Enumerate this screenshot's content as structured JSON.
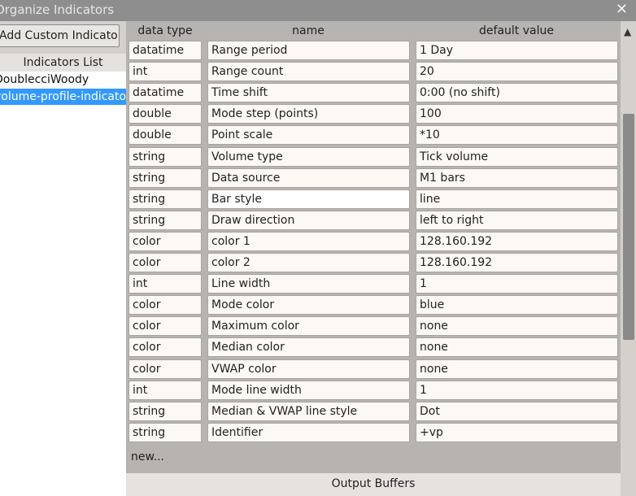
{
  "window": {
    "title": "Organize Indicators",
    "close_icon": "close-icon"
  },
  "sidebar": {
    "add_button_label": "Add Custom Indicator",
    "list_header": "Indicators List",
    "items": [
      {
        "label": "DoublecciWoody",
        "selected": false
      },
      {
        "label": "volume-profile-indicator",
        "selected": true
      }
    ]
  },
  "table": {
    "headers": {
      "type": "data type",
      "name": "name",
      "default": "default value"
    },
    "rows": [
      {
        "type": "datatime",
        "name": "Range period",
        "value": "1 Day"
      },
      {
        "type": "int",
        "name": "Range count",
        "value": "20"
      },
      {
        "type": "datatime",
        "name": "Time shift",
        "value": "0:00 (no shift)"
      },
      {
        "type": "double",
        "name": "Mode step (points)",
        "value": "100"
      },
      {
        "type": "double",
        "name": "Point scale",
        "value": "*10"
      },
      {
        "type": "string",
        "name": "Volume type",
        "value": "Tick volume"
      },
      {
        "type": "string",
        "name": "Data source",
        "value": "M1 bars"
      },
      {
        "type": "string",
        "name": "Bar style",
        "value": "line"
      },
      {
        "type": "string",
        "name": "Draw direction",
        "value": "left to right"
      },
      {
        "type": "color",
        "name": "color 1",
        "value": "128.160.192"
      },
      {
        "type": "color",
        "name": "color 2",
        "value": "128.160.192"
      },
      {
        "type": "int",
        "name": "Line width",
        "value": "1"
      },
      {
        "type": "color",
        "name": "Mode color",
        "value": "blue"
      },
      {
        "type": "color",
        "name": "Maximum color",
        "value": "none"
      },
      {
        "type": "color",
        "name": "Median color",
        "value": "none"
      },
      {
        "type": "color",
        "name": "VWAP color",
        "value": "none"
      },
      {
        "type": "int",
        "name": "Mode line width",
        "value": "1"
      },
      {
        "type": "string",
        "name": "Median & VWAP line style",
        "value": "Dot"
      },
      {
        "type": "string",
        "name": "Identifier",
        "value": "+vp"
      }
    ],
    "new_label": "new..."
  },
  "output_buffers_label": "Output Buffers",
  "colors": {
    "selection": "#3399ff",
    "titlebar": "#8e8e8e",
    "panel": "#b7b3b0"
  }
}
